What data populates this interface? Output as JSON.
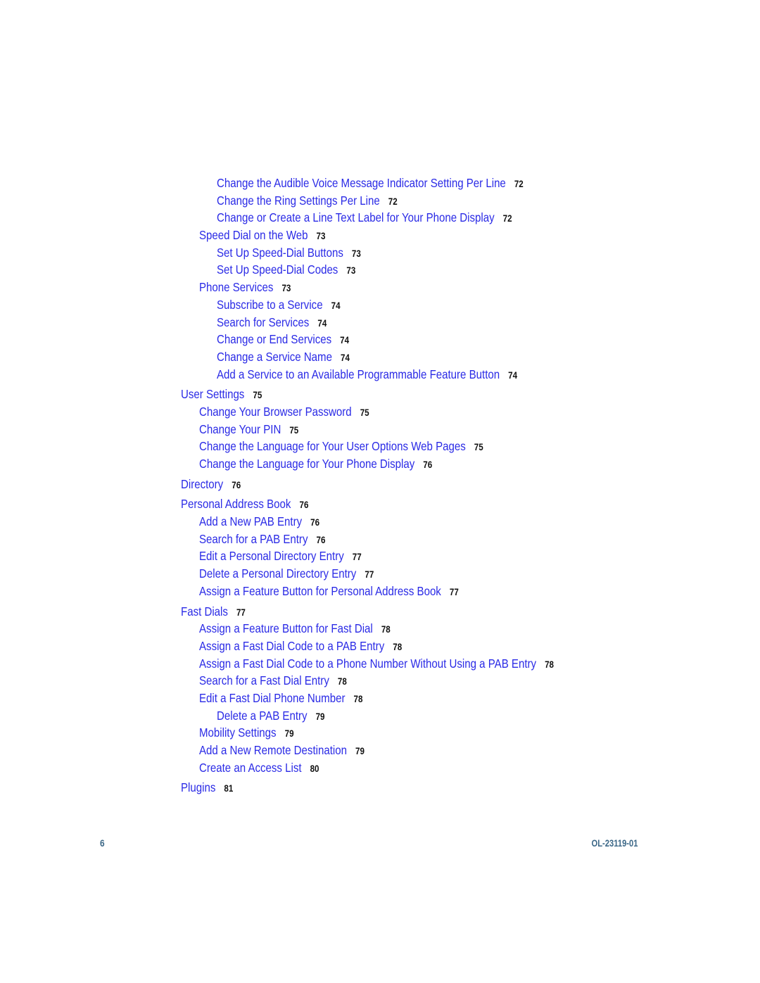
{
  "toc": [
    {
      "level": 3,
      "title": "Change the Audible Voice Message Indicator Setting Per Line",
      "page": "72"
    },
    {
      "level": 3,
      "title": "Change the Ring Settings Per Line",
      "page": "72"
    },
    {
      "level": 3,
      "title": "Change or Create a Line Text Label for Your Phone Display",
      "page": "72"
    },
    {
      "level": 2,
      "title": "Speed Dial on the Web",
      "page": "73"
    },
    {
      "level": 3,
      "title": "Set Up Speed-Dial Buttons",
      "page": "73"
    },
    {
      "level": 3,
      "title": "Set Up Speed-Dial Codes",
      "page": "73"
    },
    {
      "level": 2,
      "title": "Phone Services",
      "page": "73"
    },
    {
      "level": 3,
      "title": "Subscribe to a Service",
      "page": "74"
    },
    {
      "level": 3,
      "title": "Search for Services",
      "page": "74"
    },
    {
      "level": 3,
      "title": "Change or End Services",
      "page": "74"
    },
    {
      "level": 3,
      "title": "Change a Service Name",
      "page": "74"
    },
    {
      "level": 3,
      "title": "Add a Service to an Available Programmable Feature Button",
      "page": "74"
    },
    {
      "level": 1,
      "title": "User Settings",
      "page": "75"
    },
    {
      "level": 2,
      "title": "Change Your Browser Password",
      "page": "75"
    },
    {
      "level": 2,
      "title": "Change Your PIN",
      "page": "75"
    },
    {
      "level": 2,
      "title": "Change the Language for Your User Options Web Pages",
      "page": "75"
    },
    {
      "level": 2,
      "title": "Change the Language for Your Phone Display",
      "page": "76"
    },
    {
      "level": 1,
      "title": "Directory",
      "page": "76"
    },
    {
      "level": 1,
      "title": "Personal Address Book",
      "page": "76"
    },
    {
      "level": 2,
      "title": "Add a New PAB Entry",
      "page": "76"
    },
    {
      "level": 2,
      "title": "Search for a PAB Entry",
      "page": "76"
    },
    {
      "level": 2,
      "title": "Edit a Personal Directory Entry",
      "page": "77"
    },
    {
      "level": 2,
      "title": "Delete a Personal Directory Entry",
      "page": "77"
    },
    {
      "level": 2,
      "title": "Assign a Feature Button for Personal Address Book",
      "page": "77"
    },
    {
      "level": 1,
      "title": "Fast Dials",
      "page": "77"
    },
    {
      "level": 2,
      "title": "Assign a Feature Button for Fast Dial",
      "page": "78"
    },
    {
      "level": 2,
      "title": "Assign a Fast Dial Code to a PAB Entry",
      "page": "78"
    },
    {
      "level": 2,
      "title": "Assign a Fast Dial Code to a Phone Number Without Using a PAB Entry",
      "page": "78"
    },
    {
      "level": 2,
      "title": "Search for a Fast Dial Entry",
      "page": "78"
    },
    {
      "level": 2,
      "title": "Edit a Fast Dial Phone Number",
      "page": "78"
    },
    {
      "level": 3,
      "title": "Delete a PAB Entry",
      "page": "79"
    },
    {
      "level": 2,
      "title": "Mobility Settings",
      "page": "79"
    },
    {
      "level": 2,
      "title": "Add a New Remote Destination",
      "page": "79"
    },
    {
      "level": 2,
      "title": "Create an Access List",
      "page": "80"
    },
    {
      "level": 1,
      "title": "Plugins",
      "page": "81"
    }
  ],
  "footer": {
    "page_number": "6",
    "document_id": "OL-23119-01"
  },
  "colors": {
    "link": "#2a2ae6",
    "page_number": "#111111",
    "footer": "#3b6787"
  }
}
